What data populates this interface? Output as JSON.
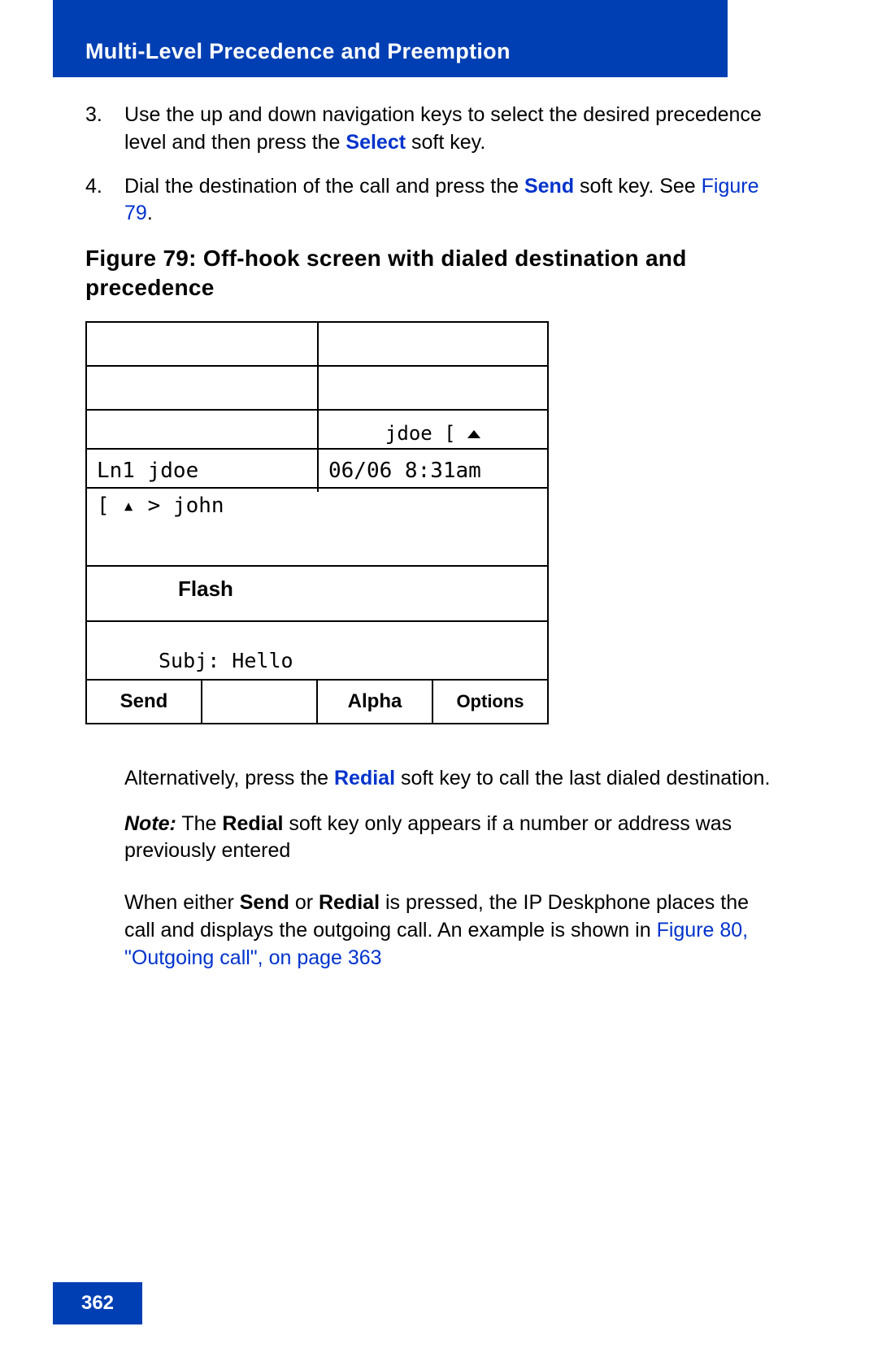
{
  "header": {
    "title": "Multi-Level Precedence and Preemption"
  },
  "steps": {
    "s3": {
      "num": "3.",
      "text_a": "Use the up and down navigation keys to select the desired precedence level and then press the ",
      "select": "Select",
      "text_b": " soft key."
    },
    "s4": {
      "num": "4.",
      "text_a": "Dial the destination of the call and press the ",
      "send": "Send",
      "text_b": " soft key. See ",
      "figref": "Figure 79",
      "text_c": "."
    }
  },
  "figure": {
    "caption": "Figure 79: Off-hook screen with dialed destination and precedence"
  },
  "phone_screen": {
    "jdoe_header": "jdoe [",
    "line_label": "Ln1 jdoe",
    "datetime": "06/06 8:31am",
    "john_line": "[ ▴ > john",
    "flash": "Flash",
    "subject": "Subj: Hello",
    "softkeys": {
      "send": "Send",
      "blank": "",
      "alpha": "Alpha",
      "options": "Options"
    }
  },
  "after": {
    "p1a": "Alternatively, press the ",
    "redial": "Redial",
    "p1b": " soft key to call the last dialed destination.",
    "note_label": "Note:",
    "note_a": " The ",
    "note_redial": "Redial",
    "note_b": " soft key only appears if a number or address was previously entered",
    "p3a": "When either ",
    "p3_send": "Send",
    "p3b": " or ",
    "p3_redial": "Redial",
    "p3c": " is pressed, the IP Deskphone places the call and displays the outgoing call. An example is shown in ",
    "figref": "Figure 80, \"Outgoing call\", on page 363"
  },
  "page_number": "362"
}
